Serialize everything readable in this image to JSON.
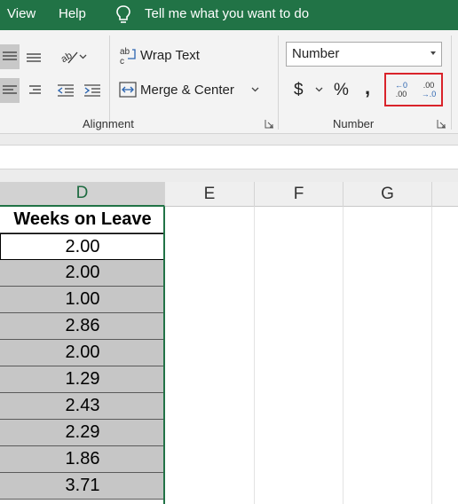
{
  "menu": {
    "view": "View",
    "help": "Help",
    "tell_me": "Tell me what you want to do"
  },
  "ribbon": {
    "wrap_text": "Wrap Text",
    "merge_center": "Merge & Center",
    "alignment_label": "Alignment",
    "number_format_value": "Number",
    "currency_symbol": "$",
    "percent_symbol": "%",
    "comma_symbol": ",",
    "increase_decimal": "Increase Decimal",
    "decrease_decimal": "Decrease Decimal",
    "number_label": "Number",
    "inc_top": "←0",
    "inc_bottom": ".00",
    "dec_top": ".00",
    "dec_bottom": "→.0"
  },
  "columns": [
    "D",
    "E",
    "F",
    "G"
  ],
  "sheet": {
    "header": "Weeks on Leave",
    "values": [
      "2.00",
      "2.00",
      "1.00",
      "2.86",
      "2.00",
      "1.29",
      "2.43",
      "2.29",
      "1.86",
      "3.71"
    ]
  },
  "colors": {
    "excel_green": "#217346",
    "highlight_red": "#d9232a",
    "selected_fill": "#c6c6c6"
  }
}
